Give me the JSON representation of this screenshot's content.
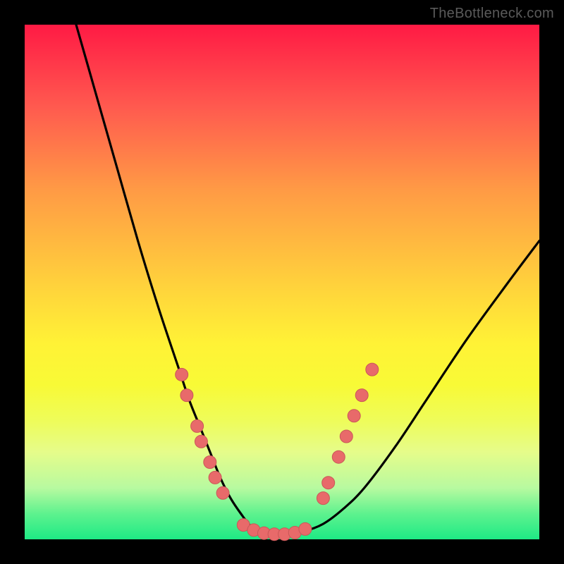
{
  "watermark": "TheBottleneck.com",
  "colors": {
    "frame": "#000000",
    "curve": "#000000",
    "dot_fill": "#e86a6a",
    "dot_stroke": "#c95858"
  },
  "chart_data": {
    "type": "line",
    "title": "",
    "xlabel": "",
    "ylabel": "",
    "xlim": [
      0,
      100
    ],
    "ylim": [
      0,
      100
    ],
    "grid": false,
    "legend": false,
    "bands": [
      {
        "name": "red-orange-yellow-gradient",
        "y_from": 100,
        "y_to": 12
      },
      {
        "name": "green-bottom",
        "y_from": 12,
        "y_to": 0
      }
    ],
    "series": [
      {
        "name": "bottleneck-curve",
        "x": [
          10,
          14,
          18,
          22,
          26,
          30,
          32,
          34,
          36,
          38,
          40,
          42,
          44,
          46,
          48,
          50,
          54,
          58,
          62,
          66,
          72,
          78,
          86,
          94,
          100
        ],
        "y": [
          100,
          86,
          72,
          58,
          45,
          33,
          27,
          22,
          17,
          12,
          8,
          5,
          2.5,
          1.5,
          1,
          1,
          1.5,
          3,
          6,
          10,
          18,
          27,
          39,
          50,
          58
        ]
      }
    ],
    "points": [
      {
        "name": "left-branch-dots",
        "coords": [
          {
            "x": 30.5,
            "y": 32
          },
          {
            "x": 31.5,
            "y": 28
          },
          {
            "x": 33.5,
            "y": 22
          },
          {
            "x": 34.3,
            "y": 19
          },
          {
            "x": 36.0,
            "y": 15
          },
          {
            "x": 37.0,
            "y": 12
          },
          {
            "x": 38.5,
            "y": 9
          }
        ]
      },
      {
        "name": "valley-floor-dots",
        "coords": [
          {
            "x": 42.5,
            "y": 2.8
          },
          {
            "x": 44.5,
            "y": 1.8
          },
          {
            "x": 46.5,
            "y": 1.2
          },
          {
            "x": 48.5,
            "y": 1.0
          },
          {
            "x": 50.5,
            "y": 1.0
          },
          {
            "x": 52.5,
            "y": 1.3
          },
          {
            "x": 54.5,
            "y": 2.0
          }
        ]
      },
      {
        "name": "right-branch-dots",
        "coords": [
          {
            "x": 58.0,
            "y": 8
          },
          {
            "x": 59.0,
            "y": 11
          },
          {
            "x": 61.0,
            "y": 16
          },
          {
            "x": 62.5,
            "y": 20
          },
          {
            "x": 64.0,
            "y": 24
          },
          {
            "x": 65.5,
            "y": 28
          },
          {
            "x": 67.5,
            "y": 33
          }
        ]
      }
    ]
  }
}
